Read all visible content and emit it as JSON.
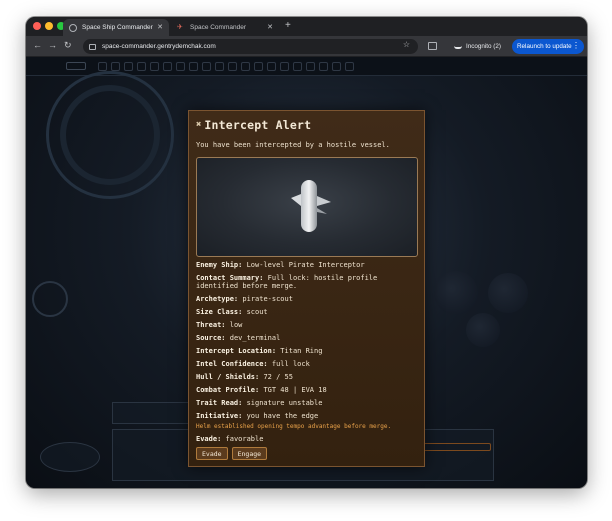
{
  "browser": {
    "tabs": [
      {
        "title": "Space Ship Commander",
        "active": true
      },
      {
        "title": "Space Commander",
        "active": false
      }
    ],
    "url": "space-commander.gentrydemchak.com",
    "incognito_label": "Incognito (2)",
    "relaunch_label": "Relaunch to update"
  },
  "modal": {
    "title": "Intercept Alert",
    "subtitle": "You have been intercepted by a hostile vessel.",
    "details": [
      {
        "key": "Enemy Ship:",
        "value": "Low-level Pirate Interceptor"
      },
      {
        "key": "Contact Summary:",
        "value": "Full lock: hostile profile identified before merge."
      },
      {
        "key": "Archetype:",
        "value": "pirate-scout"
      },
      {
        "key": "Size Class:",
        "value": "scout"
      },
      {
        "key": "Threat:",
        "value": "low"
      },
      {
        "key": "Source:",
        "value": "dev_terminal"
      },
      {
        "key": "Intercept Location:",
        "value": "Titan Ring"
      },
      {
        "key": "Intel Confidence:",
        "value": "full lock"
      },
      {
        "key": "Hull / Shields:",
        "value": "72 / 55"
      },
      {
        "key": "Combat Profile:",
        "value": "TGT 48 | EVA 18"
      },
      {
        "key": "Trait Read:",
        "value": "signature unstable"
      },
      {
        "key": "Initiative:",
        "value": "you have the edge"
      }
    ],
    "note": "Helm established opening tempo advantage before merge.",
    "evade": {
      "key": "Evade:",
      "value": "favorable"
    },
    "buttons": {
      "evade": "Evade",
      "engage": "Engage"
    }
  },
  "colors": {
    "modal_bg": "#3a2714",
    "accent_orange": "#e9a24a",
    "relaunch_blue": "#0b57d0"
  }
}
